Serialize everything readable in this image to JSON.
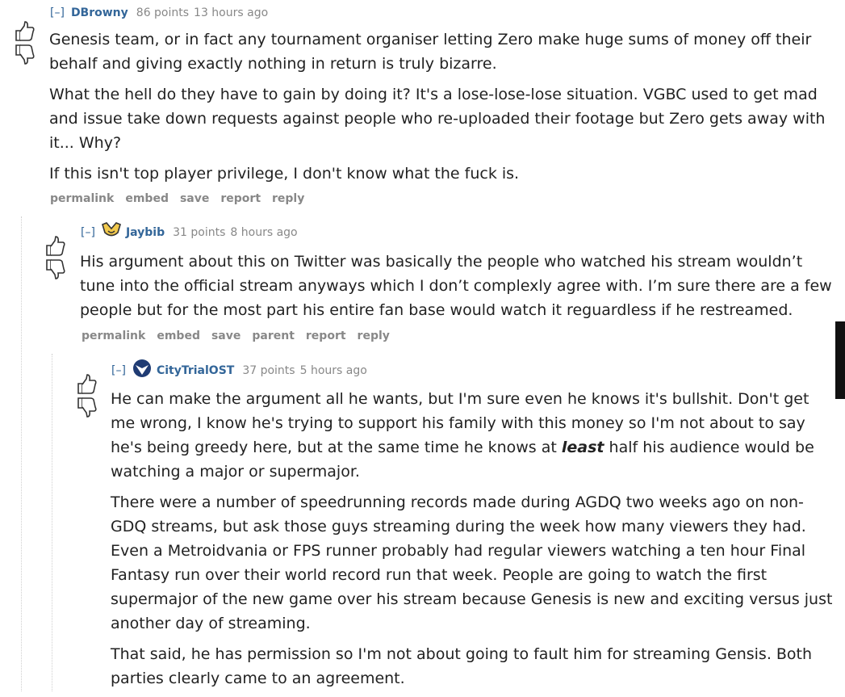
{
  "comments": [
    {
      "toggle": "[–]",
      "author": "DBrowny",
      "score": "86 points",
      "time": "13 hours ago",
      "paragraphs": [
        "Genesis team, or in fact any tournament organiser letting Zero make huge sums of money off their behalf and giving exactly nothing in return is truly bizarre.",
        "What the hell do they have to gain by doing it? It's a lose-lose-lose situation. VGBC used to get mad and issue take down requests against people who re-uploaded their footage but Zero gets away with it... Why?",
        "If this isn't top player privilege, I don't know what the fuck is."
      ],
      "actions": [
        "permalink",
        "embed",
        "save",
        "report",
        "reply"
      ]
    },
    {
      "toggle": "[–]",
      "author": "Jaybib",
      "score": "31 points",
      "time": "8 hours ago",
      "paragraphs": [
        "His argument about this on Twitter was basically the people who watched his stream wouldn’t tune into the official stream anyways which I don’t complexly agree with. I’m sure there are a few people but for the most part his entire fan base would watch it reguardless if he restreamed."
      ],
      "actions": [
        "permalink",
        "embed",
        "save",
        "parent",
        "report",
        "reply"
      ]
    },
    {
      "toggle": "[–]",
      "author": "CityTrialOST",
      "score": "37 points",
      "time": "5 hours ago",
      "p1_before": "He can make the argument all he wants, but I'm sure even he knows it's bullshit. Don't get me wrong, I know he's trying to support his family with this money so I'm not about to say he's being greedy here, but at the same time he knows at ",
      "p1_emph": "least",
      "p1_after": " half his audience would be watching a major or supermajor.",
      "p2": "There were a number of speedrunning records made during AGDQ two weeks ago on non-GDQ streams, but ask those guys streaming during the week how many viewers they had. Even a Metroidvania or FPS runner probably had regular viewers watching a ten hour Final Fantasy run over their world record run that week. People are going to watch the first supermajor of the new game over his stream because Genesis is new and exciting versus just another day of streaming.",
      "p3": "That said, he has permission so I'm not about going to fault him for streaming Gensis. Both parties clearly came to an agreement."
    }
  ],
  "icons": {
    "upvote": "thumbs-up-icon",
    "downvote": "thumbs-down-icon"
  },
  "colors": {
    "author": "#336699",
    "meta": "#888888",
    "text": "#222222"
  }
}
